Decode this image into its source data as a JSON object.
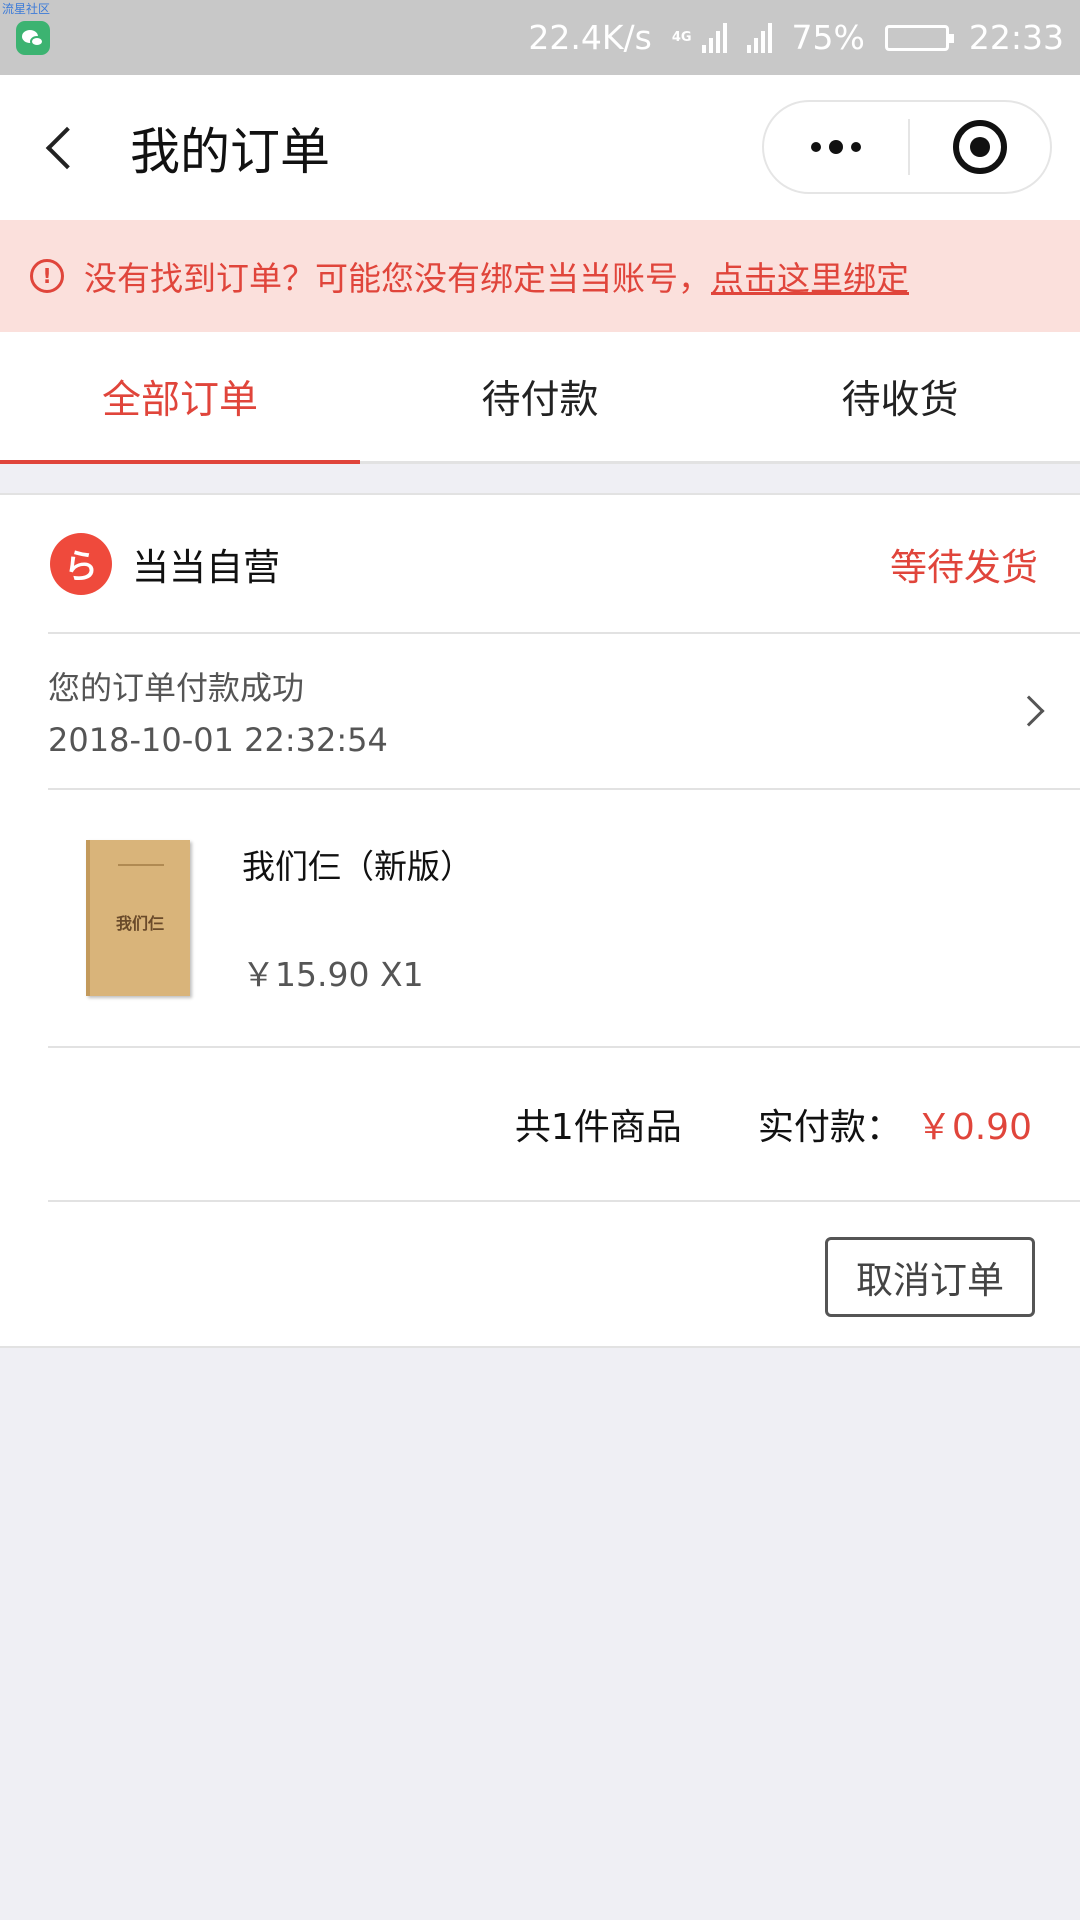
{
  "status_bar": {
    "watermark": "流星社区",
    "speed": "22.4K/s",
    "network": "4G",
    "battery": "75%",
    "battery_level": 0.75,
    "time": "22:33"
  },
  "nav": {
    "title": "我的订单"
  },
  "notice": {
    "text": "没有找到订单？可能您没有绑定当当账号，",
    "link": "点击这里绑定"
  },
  "tabs": [
    {
      "label": "全部订单",
      "active": true
    },
    {
      "label": "待付款",
      "active": false
    },
    {
      "label": "待收货",
      "active": false
    }
  ],
  "order": {
    "shop_name": "当当自营",
    "status": "等待发货",
    "message": "您的订单付款成功",
    "message_time": "2018-10-01 22:32:54",
    "item": {
      "title": "我们仨（新版）",
      "price": "￥15.90 X1",
      "cover_text": "我们仨"
    },
    "count": "共1件商品",
    "paid_label": "实付款：",
    "paid_amount": "￥0.90",
    "cancel_label": "取消订单"
  },
  "colors": {
    "accent": "#e0453b",
    "notice_bg": "#fbe0dc",
    "page_bg": "#efeff4"
  }
}
